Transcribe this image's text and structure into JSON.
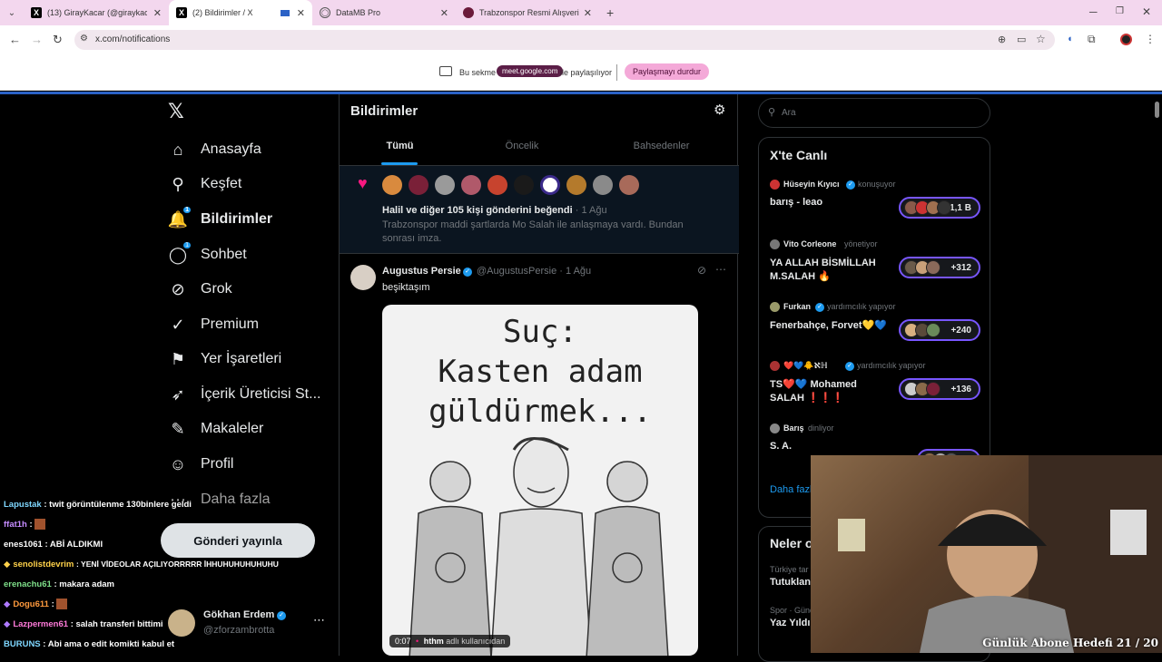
{
  "browser": {
    "tabs": [
      {
        "label": "(13) GirayKacar (@giraykacar) /",
        "icon": "x-logo"
      },
      {
        "label": "(2) Bildirimler / X",
        "icon": "x-logo"
      },
      {
        "label": "DataMB Pro",
        "icon": "globe"
      },
      {
        "label": "Trabzonspor Resmi Alışveriş Sit",
        "icon": "ts-logo"
      }
    ],
    "url": "x.com/notifications",
    "share_bar": {
      "prefix": "Bu sekme",
      "host": "meet.google.com",
      "suffix": "ile paylaşılıyor",
      "stop_label": "Paylaşmayı durdur"
    }
  },
  "nav": {
    "items": [
      {
        "label": "Anasayfa",
        "icon": "home"
      },
      {
        "label": "Keşfet",
        "icon": "search"
      },
      {
        "label": "Bildirimler",
        "icon": "bell",
        "badge": "1"
      },
      {
        "label": "Sohbet",
        "icon": "chat",
        "badge": "1"
      },
      {
        "label": "Grok",
        "icon": "grok"
      },
      {
        "label": "Premium",
        "icon": "premium"
      },
      {
        "label": "Yer İşaretleri",
        "icon": "bookmark"
      },
      {
        "label": "İçerik Üreticisi St...",
        "icon": "rocket"
      },
      {
        "label": "Makaleler",
        "icon": "article"
      },
      {
        "label": "Profil",
        "icon": "person"
      },
      {
        "label": "Daha fazla",
        "icon": "more"
      }
    ],
    "post_button": "Gönderi yayınla",
    "account": {
      "name": "Gökhan Erdem",
      "handle": "@zforzambrotta"
    }
  },
  "notifications": {
    "title": "Bildirimler",
    "tabs": [
      "Tümü",
      "Öncelik",
      "Bahsedenler"
    ],
    "like_item": {
      "text": "Halil ve diğer 105 kişi gönderini beğendi",
      "time": "· 1 Ağu",
      "snippet": "Trabzonspor maddi şartlarda Mo Salah ile anlaşmaya vardı. Bundan sonrası imza."
    },
    "post": {
      "name": "Augustus Persie",
      "handle": "@AugustusPersie",
      "time": "· 1 Ağu",
      "text": "beşiktaşım",
      "image_text_1": "Suç:",
      "image_text_2": "Kasten adam",
      "image_text_3": "güldürmek...",
      "video_time": "0:07",
      "video_user": "hthm",
      "video_suffix": "adlı kullanıcıdan"
    }
  },
  "right": {
    "search_placeholder": "Ara",
    "live_title": "X'te Canlı",
    "live": [
      {
        "host": "Hüseyin Kıyıcı",
        "role": "konuşuyor",
        "title": "barış - leao",
        "count": "+1,1 B"
      },
      {
        "host": "Vito Corleone",
        "role": "yönetiyor",
        "title": "YA ALLAH BİSMİLLAH M.SALAH 🔥",
        "count": "+312"
      },
      {
        "host": "Furkan",
        "role": "yardımcılık yapıyor",
        "title": "Fenerbahçe, Forvet💛💙",
        "count": "+240"
      },
      {
        "host": "❤️💙🐥ℵℍ",
        "role": "yardımcılık yapıyor",
        "title": "TS❤️💙 Mohamed SALAH ❗❗❗",
        "count": "+136"
      },
      {
        "host": "Barış",
        "role": "dinliyor",
        "title": "S. A.",
        "count": "+7"
      }
    ],
    "more_label": "Daha fazl",
    "trends_title": "Neler o",
    "trends": [
      {
        "meta": "Türkiye tar",
        "title": "Tutuklan"
      },
      {
        "meta": "Spor · Günd",
        "title": "Yaz Yıldı"
      }
    ]
  },
  "stream": {
    "chat": [
      {
        "user": "Lapustak",
        "msg": ": twit görüntülenme 130binlere geldi",
        "color": "#7fd7ff"
      },
      {
        "user": "ffat1h",
        "msg": ":",
        "color": "#c58cff"
      },
      {
        "user": "enes1061",
        "msg": ": ABİ ALDIKMI",
        "color": "#ffffff"
      },
      {
        "user": "senolistdevrim",
        "msg": ": YENİ VİDEOLAR AÇILIYORRRRR İHHUHUHUHUHUHU",
        "color": "#ffd24a"
      },
      {
        "user": "erenachu61",
        "msg": ": makara adam",
        "color": "#7fe08a"
      },
      {
        "user": "Dogu611",
        "msg": ":",
        "color": "#ff9a3d"
      },
      {
        "user": "Lazpermen61",
        "msg": ": salah transferi bittimi",
        "color": "#ff7ad9"
      },
      {
        "user": "BURUNS",
        "msg": ": Abi ama o edit komikti kabul et",
        "color": "#7fd7ff"
      }
    ],
    "goal": "Günlük Abone Hedefi 21 / 20"
  }
}
